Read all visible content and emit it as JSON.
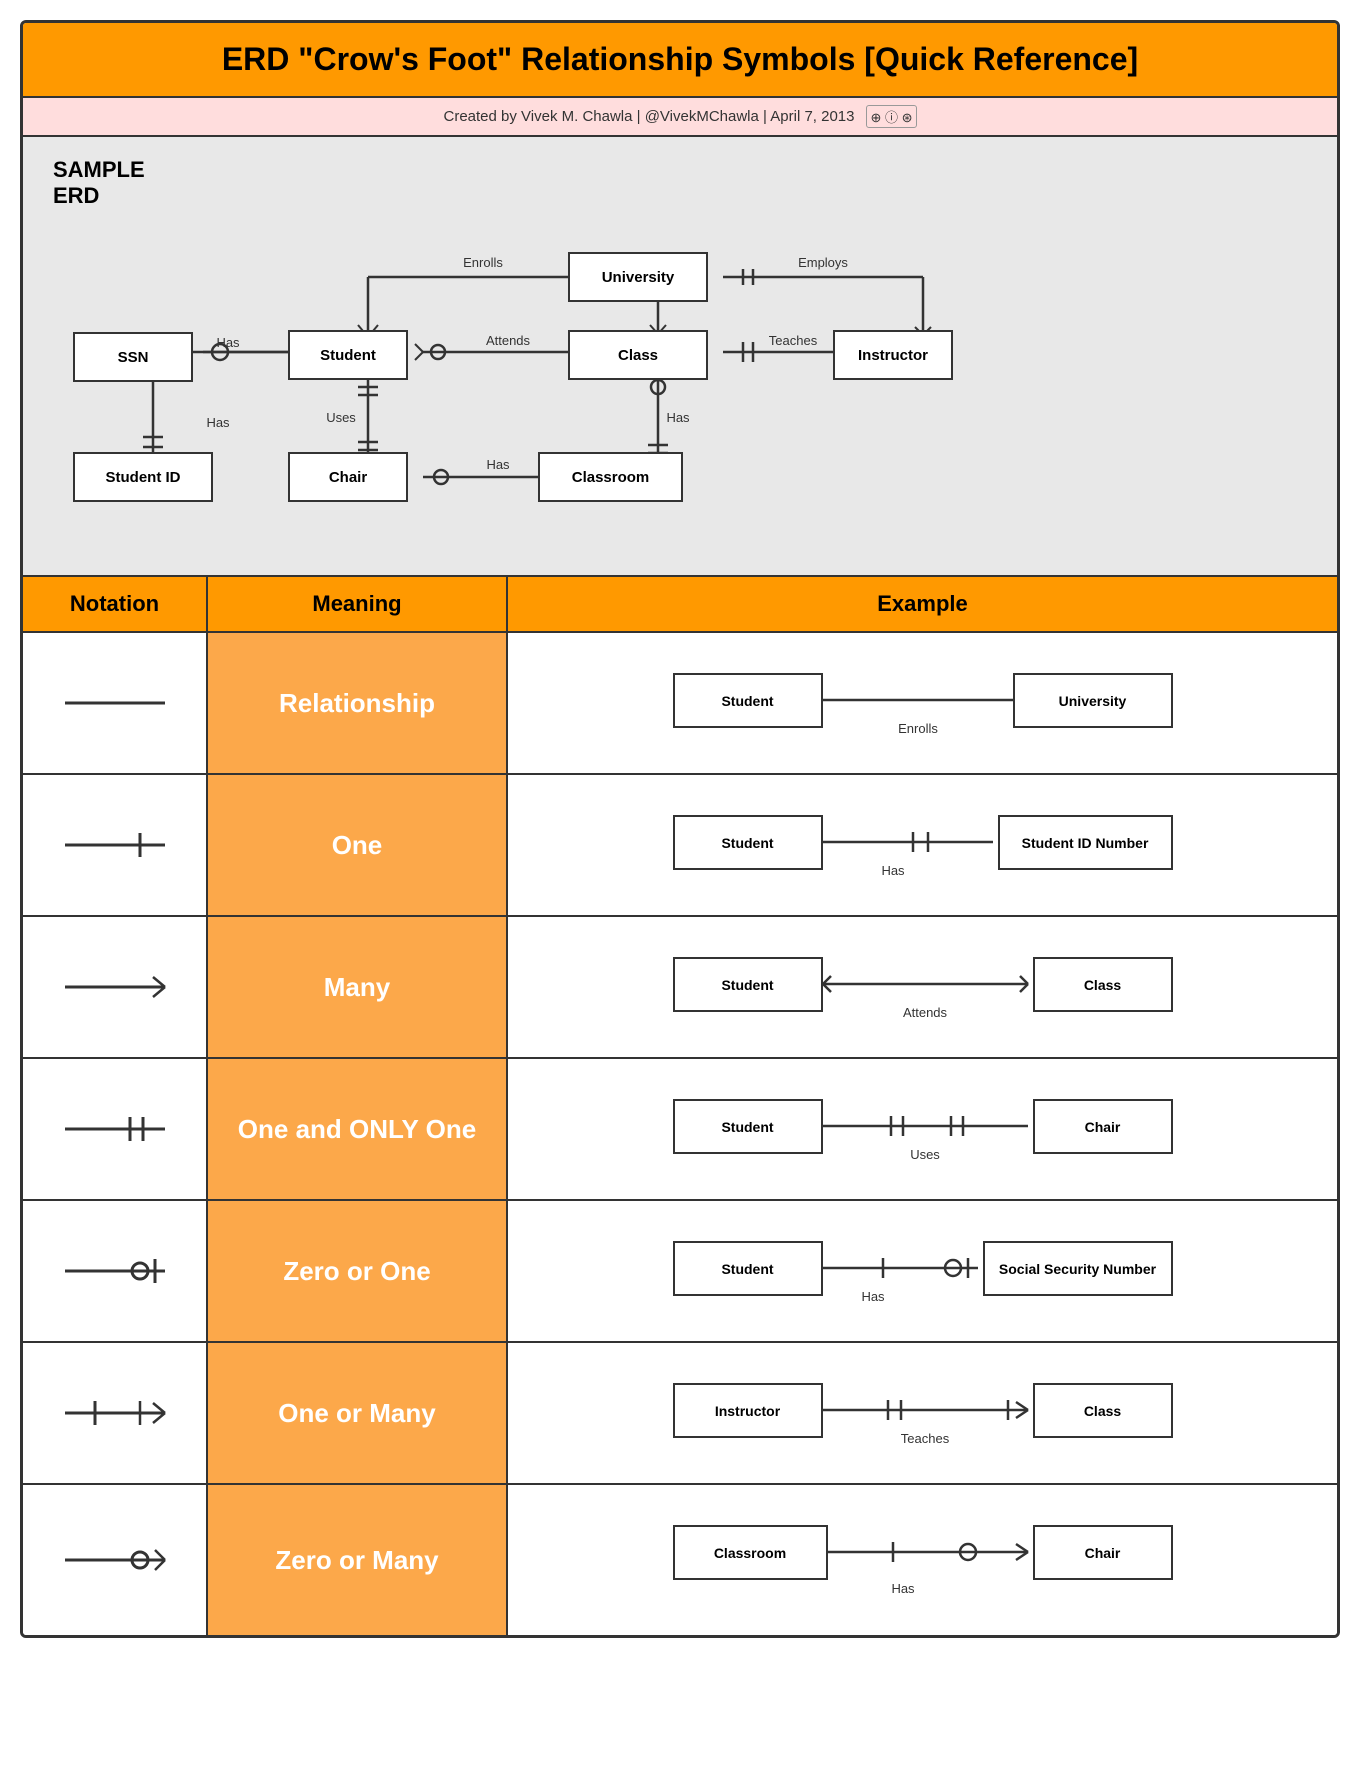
{
  "title": "ERD \"Crow's Foot\" Relationship Symbols [Quick Reference]",
  "subtitle": "Created by Vivek M. Chawla | @VivekMChawla | April 7, 2013",
  "erd_label": "SAMPLE\nERD",
  "header": {
    "notation": "Notation",
    "meaning": "Meaning",
    "example": "Example"
  },
  "rows": [
    {
      "meaning": "Relationship",
      "ex_left": "Student",
      "ex_right": "University",
      "ex_rel": "Enrolls",
      "type": "relationship"
    },
    {
      "meaning": "One",
      "ex_left": "Student",
      "ex_right": "Student ID Number",
      "ex_rel": "Has",
      "type": "one"
    },
    {
      "meaning": "Many",
      "ex_left": "Student",
      "ex_right": "Class",
      "ex_rel": "Attends",
      "type": "many"
    },
    {
      "meaning": "One and ONLY One",
      "ex_left": "Student",
      "ex_right": "Chair",
      "ex_rel": "Uses",
      "type": "one_only"
    },
    {
      "meaning": "Zero or One",
      "ex_left": "Student",
      "ex_right": "Social Security Number",
      "ex_rel": "Has",
      "type": "zero_one"
    },
    {
      "meaning": "One or Many",
      "ex_left": "Instructor",
      "ex_right": "Class",
      "ex_rel": "Teaches",
      "type": "one_many"
    },
    {
      "meaning": "Zero or Many",
      "ex_left": "Classroom",
      "ex_right": "Chair",
      "ex_rel": "Has",
      "type": "zero_many"
    }
  ]
}
